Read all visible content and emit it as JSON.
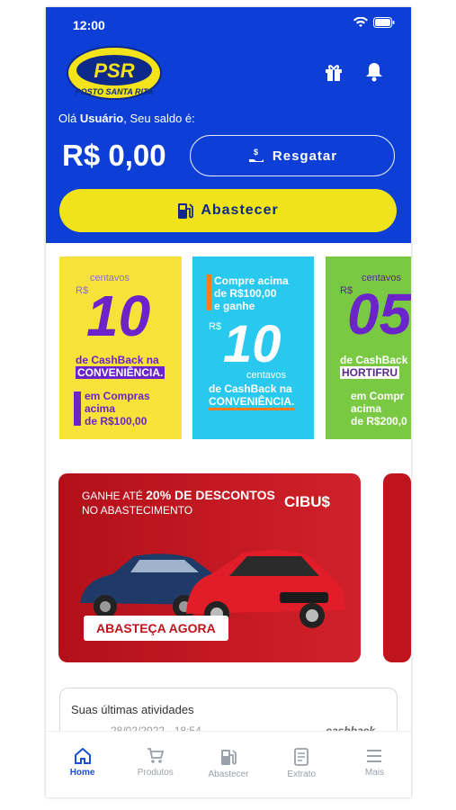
{
  "status": {
    "time": "12:00"
  },
  "logo": {
    "brand": "PSR",
    "name": "POSTO SANTA RITA"
  },
  "greeting": {
    "prefix": "Olá ",
    "user": "Usuário",
    "suffix": ", Seu saldo é:"
  },
  "balance": {
    "amount": "R$ 0,00"
  },
  "buttons": {
    "resgatar": "Resgatar",
    "abastecer": "Abastecer"
  },
  "promos": [
    {
      "top": "centavos",
      "currency": "R$",
      "value": "10",
      "line1": "de CashBack na",
      "line2": "CONVENIÊNCIA.",
      "line3": "em Compras",
      "line4": "acima",
      "line5": "de R$100,00"
    },
    {
      "line1": "Compre acima",
      "line2": "de R$100,00",
      "line3": "e ganhe",
      "currency": "R$",
      "value": "10",
      "unit": "centavos",
      "line4": "de CashBack na",
      "line5": "CONVENIÊNCIA."
    },
    {
      "top": "centavos",
      "currency": "R$",
      "value": "05",
      "line1": "de CashBack",
      "line2": "HORTIFRU",
      "line3": "em Compr",
      "line4": "acima",
      "line5": "de R$200,0"
    }
  ],
  "banner": {
    "line1_prefix": "GANHE ATÉ ",
    "line1_bold": "20% DE DESCONTOS",
    "line2": "NO ABASTECIMENTO",
    "brand": "CIBU$",
    "cta": "ABASTEÇA AGORA"
  },
  "activity": {
    "title": "Suas últimas atividades",
    "date": "28/02/2022 - 18:54",
    "type": "cashback"
  },
  "tabs": [
    {
      "label": "Home",
      "icon": "home-icon"
    },
    {
      "label": "Produtos",
      "icon": "cart-icon"
    },
    {
      "label": "Abastecer",
      "icon": "fuel-pump-icon"
    },
    {
      "label": "Extrato",
      "icon": "receipt-icon"
    },
    {
      "label": "Mais",
      "icon": "menu-icon"
    }
  ],
  "colors": {
    "header": "#0d3fd6",
    "accent_yellow": "#f1e31a",
    "active_tab": "#1b4fd8"
  }
}
